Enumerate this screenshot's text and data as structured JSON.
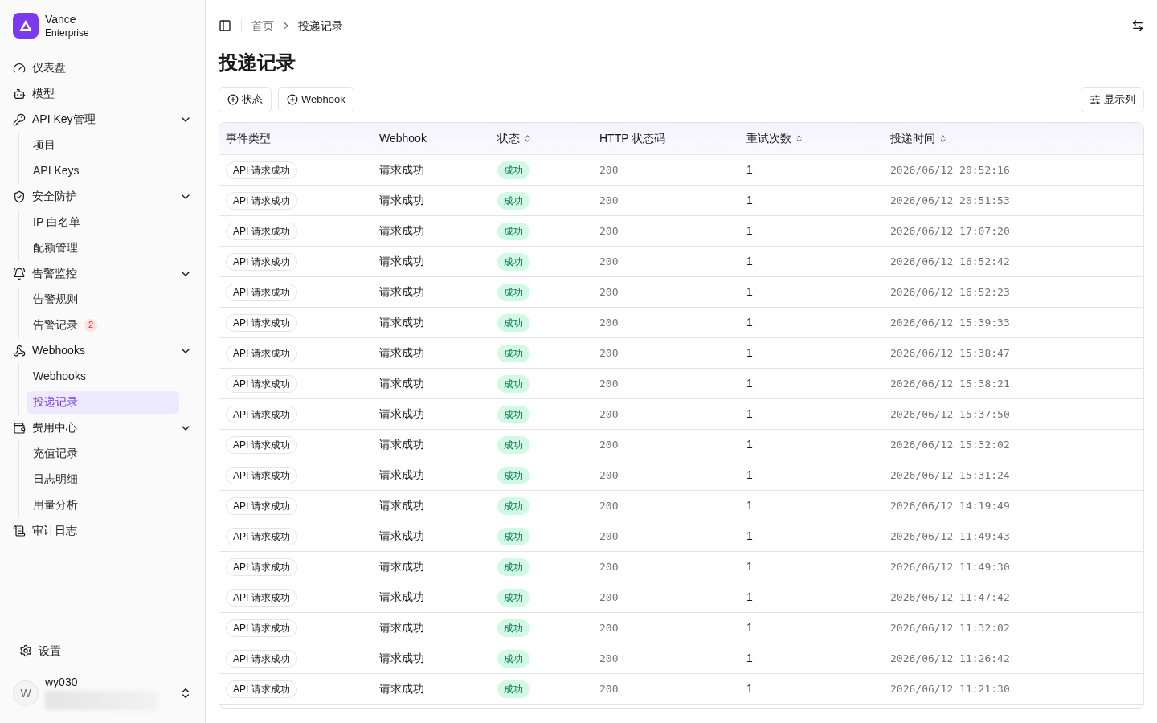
{
  "brand": {
    "name": "Vance",
    "subtitle": "Enterprise"
  },
  "nav": [
    {
      "label": "仪表盘",
      "selected": false
    },
    {
      "label": "模型",
      "selected": false
    },
    {
      "label": "API Key管理",
      "selected": false,
      "expanded": true,
      "children": [
        {
          "label": "项目",
          "selected": false
        },
        {
          "label": "API Keys",
          "selected": false
        }
      ]
    },
    {
      "label": "安全防护",
      "selected": false,
      "expanded": true,
      "children": [
        {
          "label": "IP 白名单",
          "selected": false
        },
        {
          "label": "配额管理",
          "selected": false
        }
      ]
    },
    {
      "label": "告警监控",
      "selected": false,
      "expanded": true,
      "children": [
        {
          "label": "告警规则",
          "selected": false
        },
        {
          "label": "告警记录",
          "selected": false,
          "badge": "2"
        }
      ]
    },
    {
      "label": "Webhooks",
      "selected": false,
      "expanded": true,
      "children": [
        {
          "label": "Webhooks",
          "selected": false
        },
        {
          "label": "投递记录",
          "selected": true
        }
      ]
    },
    {
      "label": "费用中心",
      "selected": false,
      "expanded": true,
      "children": [
        {
          "label": "充值记录",
          "selected": false
        },
        {
          "label": "日志明细",
          "selected": false
        },
        {
          "label": "用量分析",
          "selected": false
        }
      ]
    },
    {
      "label": "审计日志",
      "selected": false
    }
  ],
  "settings": "设置",
  "user": {
    "initial": "W",
    "name": "wy030"
  },
  "breadcrumb": [
    "首页",
    "投递记录"
  ],
  "title": "投递记录",
  "filters": [
    "状态",
    "Webhook"
  ],
  "columns_button": "显示列",
  "table": {
    "columns": [
      {
        "label": "事件类型",
        "sortable": false
      },
      {
        "label": "Webhook",
        "sortable": false
      },
      {
        "label": "状态",
        "sortable": true
      },
      {
        "label": "HTTP 状态码",
        "sortable": false
      },
      {
        "label": "重试次数",
        "sortable": true
      },
      {
        "label": "投递时间",
        "sortable": true
      }
    ],
    "rows": [
      {
        "event": "API 请求成功",
        "webhook": "请求成功",
        "status": "成功",
        "code": "200",
        "retries": "1",
        "time": "2026/06/12 20:52:16"
      },
      {
        "event": "API 请求成功",
        "webhook": "请求成功",
        "status": "成功",
        "code": "200",
        "retries": "1",
        "time": "2026/06/12 20:51:53"
      },
      {
        "event": "API 请求成功",
        "webhook": "请求成功",
        "status": "成功",
        "code": "200",
        "retries": "1",
        "time": "2026/06/12 17:07:20"
      },
      {
        "event": "API 请求成功",
        "webhook": "请求成功",
        "status": "成功",
        "code": "200",
        "retries": "1",
        "time": "2026/06/12 16:52:42"
      },
      {
        "event": "API 请求成功",
        "webhook": "请求成功",
        "status": "成功",
        "code": "200",
        "retries": "1",
        "time": "2026/06/12 16:52:23"
      },
      {
        "event": "API 请求成功",
        "webhook": "请求成功",
        "status": "成功",
        "code": "200",
        "retries": "1",
        "time": "2026/06/12 15:39:33"
      },
      {
        "event": "API 请求成功",
        "webhook": "请求成功",
        "status": "成功",
        "code": "200",
        "retries": "1",
        "time": "2026/06/12 15:38:47"
      },
      {
        "event": "API 请求成功",
        "webhook": "请求成功",
        "status": "成功",
        "code": "200",
        "retries": "1",
        "time": "2026/06/12 15:38:21"
      },
      {
        "event": "API 请求成功",
        "webhook": "请求成功",
        "status": "成功",
        "code": "200",
        "retries": "1",
        "time": "2026/06/12 15:37:50"
      },
      {
        "event": "API 请求成功",
        "webhook": "请求成功",
        "status": "成功",
        "code": "200",
        "retries": "1",
        "time": "2026/06/12 15:32:02"
      },
      {
        "event": "API 请求成功",
        "webhook": "请求成功",
        "status": "成功",
        "code": "200",
        "retries": "1",
        "time": "2026/06/12 15:31:24"
      },
      {
        "event": "API 请求成功",
        "webhook": "请求成功",
        "status": "成功",
        "code": "200",
        "retries": "1",
        "time": "2026/06/12 14:19:49"
      },
      {
        "event": "API 请求成功",
        "webhook": "请求成功",
        "status": "成功",
        "code": "200",
        "retries": "1",
        "time": "2026/06/12 11:49:43"
      },
      {
        "event": "API 请求成功",
        "webhook": "请求成功",
        "status": "成功",
        "code": "200",
        "retries": "1",
        "time": "2026/06/12 11:49:30"
      },
      {
        "event": "API 请求成功",
        "webhook": "请求成功",
        "status": "成功",
        "code": "200",
        "retries": "1",
        "time": "2026/06/12 11:47:42"
      },
      {
        "event": "API 请求成功",
        "webhook": "请求成功",
        "status": "成功",
        "code": "200",
        "retries": "1",
        "time": "2026/06/12 11:32:02"
      },
      {
        "event": "API 请求成功",
        "webhook": "请求成功",
        "status": "成功",
        "code": "200",
        "retries": "1",
        "time": "2026/06/12 11:26:42"
      },
      {
        "event": "API 请求成功",
        "webhook": "请求成功",
        "status": "成功",
        "code": "200",
        "retries": "1",
        "time": "2026/06/12 11:21:30"
      }
    ]
  }
}
